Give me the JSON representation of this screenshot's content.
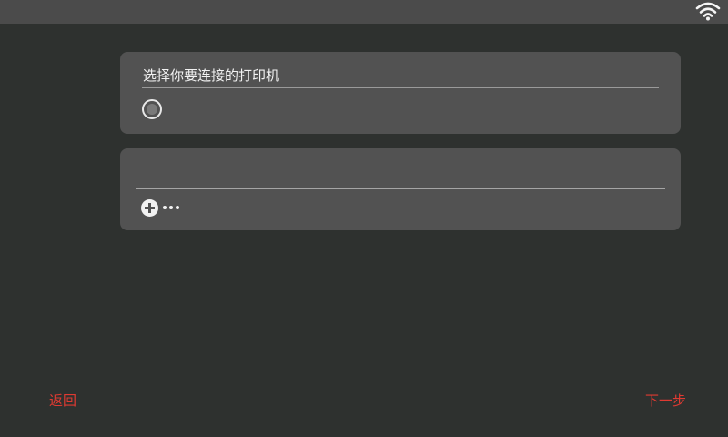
{
  "status_bar": {
    "wifi_icon": "wifi-icon"
  },
  "printer_panel": {
    "title": "选择你要连接的打印机",
    "radio_selected": false
  },
  "add_panel": {
    "add_icon": "plus-circle-icon",
    "more_icon": "more-dots-icon"
  },
  "footer": {
    "back_label": "返回",
    "next_label": "下一步"
  },
  "colors": {
    "background": "#2e312f",
    "status_bar": "#4b4b4b",
    "panel": "#525252",
    "accent_red": "#e03a32"
  }
}
